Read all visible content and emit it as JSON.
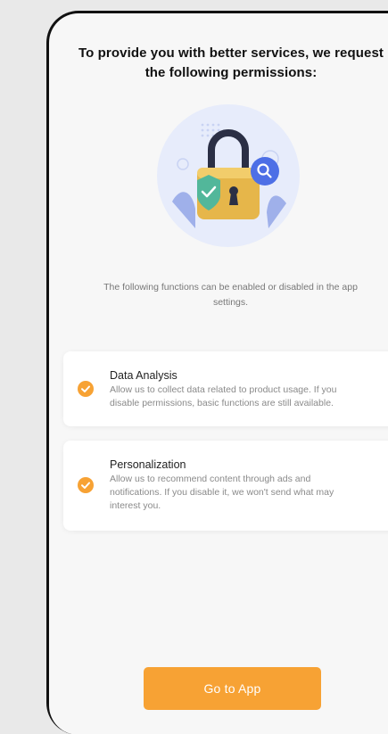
{
  "permissions_dialog": {
    "title_line1": "To provide you with better services, we request",
    "title_line2": "the following permissions:",
    "illustration_icon": "padlock-with-shield-and-magnifier-illustration",
    "subtitle_line1": "The following functions can be enabled or disabled in the app",
    "subtitle_line2": "settings."
  },
  "permissions": [
    {
      "title": "Data Analysis",
      "description_line1": "Allow us to collect data related to product usage. If you",
      "description_line2": "disable permissions, basic functions are still available.",
      "checked": true
    },
    {
      "title": "Personalization",
      "description_line1": "Allow us to recommend content through ads and",
      "description_line2": "notifications. If you disable it, we won't send what may",
      "description_line3": "interest you.",
      "checked": true
    }
  ],
  "actions": {
    "go_to_app_label": "Go to App"
  },
  "colors": {
    "accent": "#f7a234",
    "background": "#f7f7f7",
    "device_frame": "#111111",
    "illustration_circle": "#e7ecfb",
    "lock_body": "#e6b64a",
    "shield": "#52b79a",
    "magnifier": "#4d6fe6"
  }
}
